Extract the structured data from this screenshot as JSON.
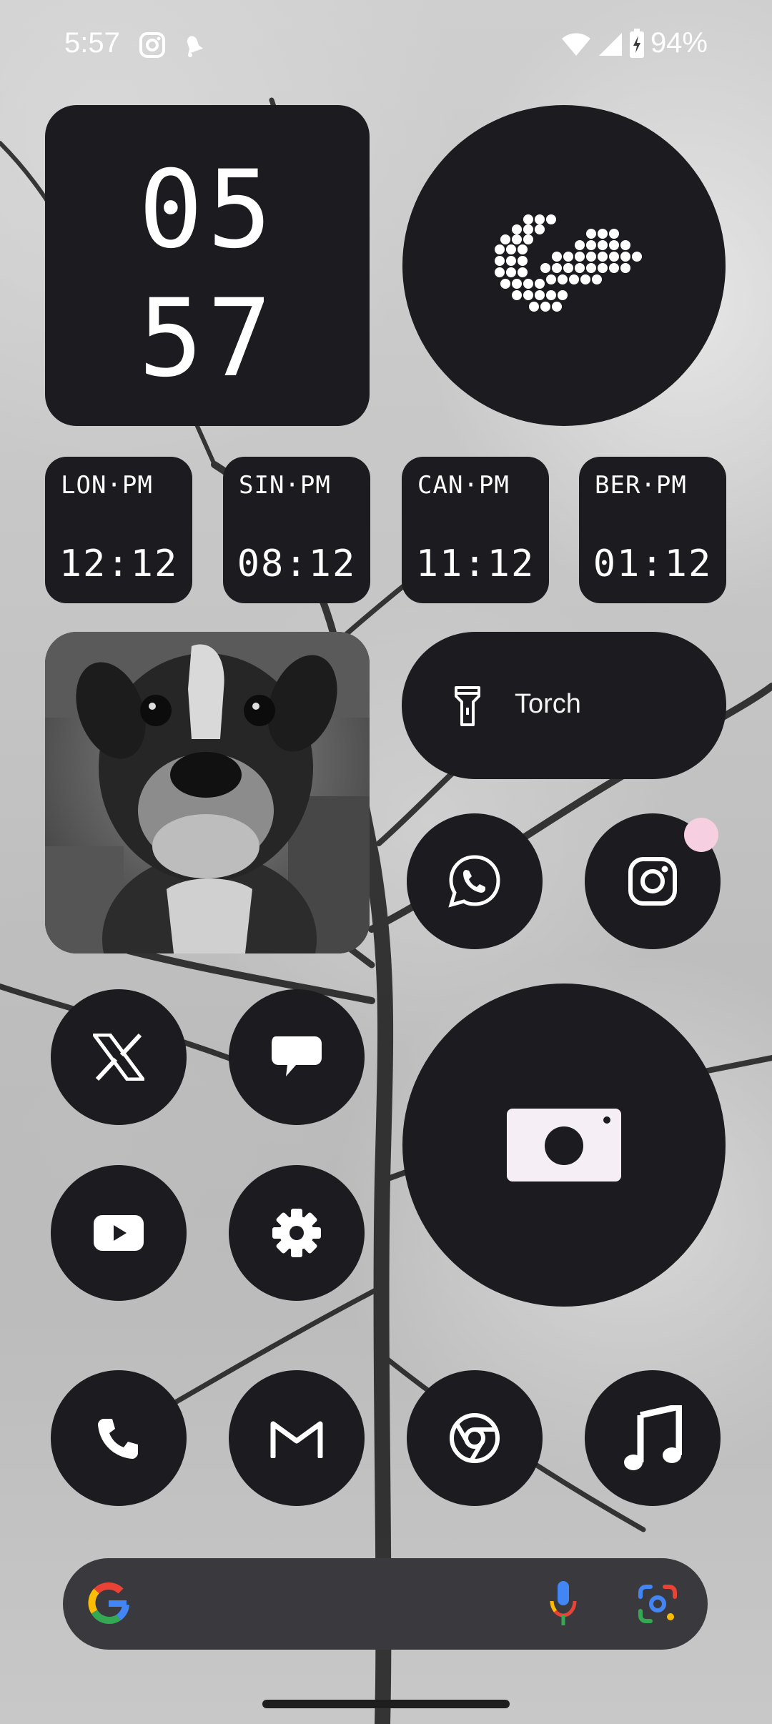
{
  "status_bar": {
    "time": "5:57",
    "battery": "94%",
    "notification_icons": [
      "instagram-icon",
      "bell-icon"
    ],
    "system_icons": [
      "wifi-icon",
      "signal-icon",
      "battery-charging-icon"
    ]
  },
  "clock_widget": {
    "hour": "05",
    "minute": "57"
  },
  "world_clocks": [
    {
      "city": "LON·PM",
      "time": "12:12"
    },
    {
      "city": "SIN·PM",
      "time": "08:12"
    },
    {
      "city": "CAN·PM",
      "time": "11:12"
    },
    {
      "city": "BER·PM",
      "time": "01:12"
    }
  ],
  "torch": {
    "label": "Torch"
  },
  "apps": [
    "whatsapp-icon",
    "instagram-icon",
    "x-icon",
    "messages-icon",
    "camera-icon",
    "youtube-icon",
    "settings-icon",
    "phone-icon",
    "gmail-icon",
    "chrome-icon",
    "music-icon"
  ],
  "colors": {
    "tile": "#1c1b20",
    "search_bar": "#3a3a3e",
    "badge": "#f6cfe1"
  }
}
